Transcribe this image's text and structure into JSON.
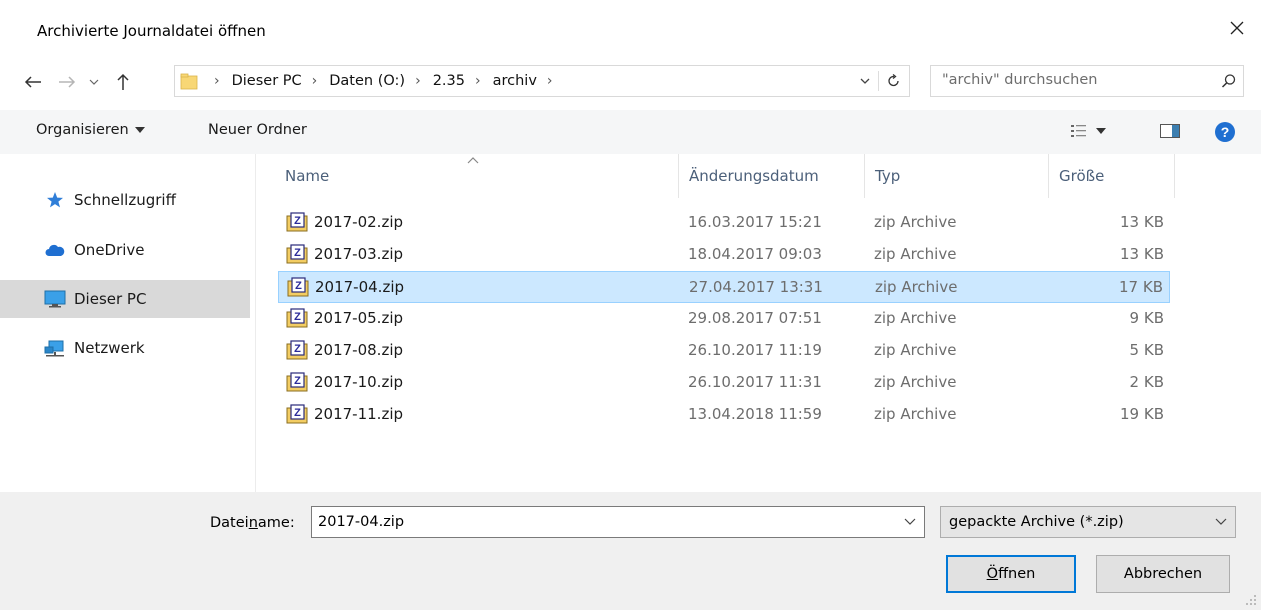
{
  "window": {
    "title": "Archivierte Journaldatei öffnen",
    "close_label": "✕"
  },
  "nav": {
    "back": "←",
    "forward": "→",
    "recent": "⌄",
    "up": "↑",
    "breadcrumbs": [
      {
        "label": "Dieser PC"
      },
      {
        "label": "Daten (O:)"
      },
      {
        "label": "2.35"
      },
      {
        "label": "archiv"
      }
    ],
    "search_placeholder": "\"archiv\" durchsuchen"
  },
  "toolbar": {
    "organize_label": "Organisieren",
    "new_folder_label": "Neuer Ordner"
  },
  "sidebar": {
    "items": [
      {
        "label": "Schnellzugriff",
        "icon": "star-icon"
      },
      {
        "label": "OneDrive",
        "icon": "cloud-icon"
      },
      {
        "label": "Dieser PC",
        "icon": "monitor-icon",
        "selected": true
      },
      {
        "label": "Netzwerk",
        "icon": "network-icon"
      }
    ]
  },
  "table": {
    "columns": {
      "name": "Name",
      "date": "Änderungsdatum",
      "type": "Typ",
      "size": "Größe"
    },
    "rows": [
      {
        "name": "2017-02.zip",
        "date": "16.03.2017 15:21",
        "type": "zip Archive",
        "size": "13 KB"
      },
      {
        "name": "2017-03.zip",
        "date": "18.04.2017 09:03",
        "type": "zip Archive",
        "size": "13 KB"
      },
      {
        "name": "2017-04.zip",
        "date": "27.04.2017 13:31",
        "type": "zip Archive",
        "size": "17 KB",
        "selected": true
      },
      {
        "name": "2017-05.zip",
        "date": "29.08.2017 07:51",
        "type": "zip Archive",
        "size": "9 KB"
      },
      {
        "name": "2017-08.zip",
        "date": "26.10.2017 11:19",
        "type": "zip Archive",
        "size": "5 KB"
      },
      {
        "name": "2017-10.zip",
        "date": "26.10.2017 11:31",
        "type": "zip Archive",
        "size": "2 KB"
      },
      {
        "name": "2017-11.zip",
        "date": "13.04.2018 11:59",
        "type": "zip Archive",
        "size": "19 KB"
      }
    ]
  },
  "footer": {
    "filename_label_pre": "Datei",
    "filename_label_accel": "n",
    "filename_label_post": "ame:",
    "filename_value": "2017-04.zip",
    "filetype_value": "gepackte Archive (*.zip)",
    "open_accel": "Ö",
    "open_rest": "ffnen",
    "cancel_label": "Abbrechen"
  },
  "colors": {
    "selection_bg": "#cce8ff",
    "selection_border": "#99d1ff",
    "accent": "#0078d7",
    "toolbar_bg": "#f5f6f7",
    "footer_bg": "#f0f0f0"
  }
}
